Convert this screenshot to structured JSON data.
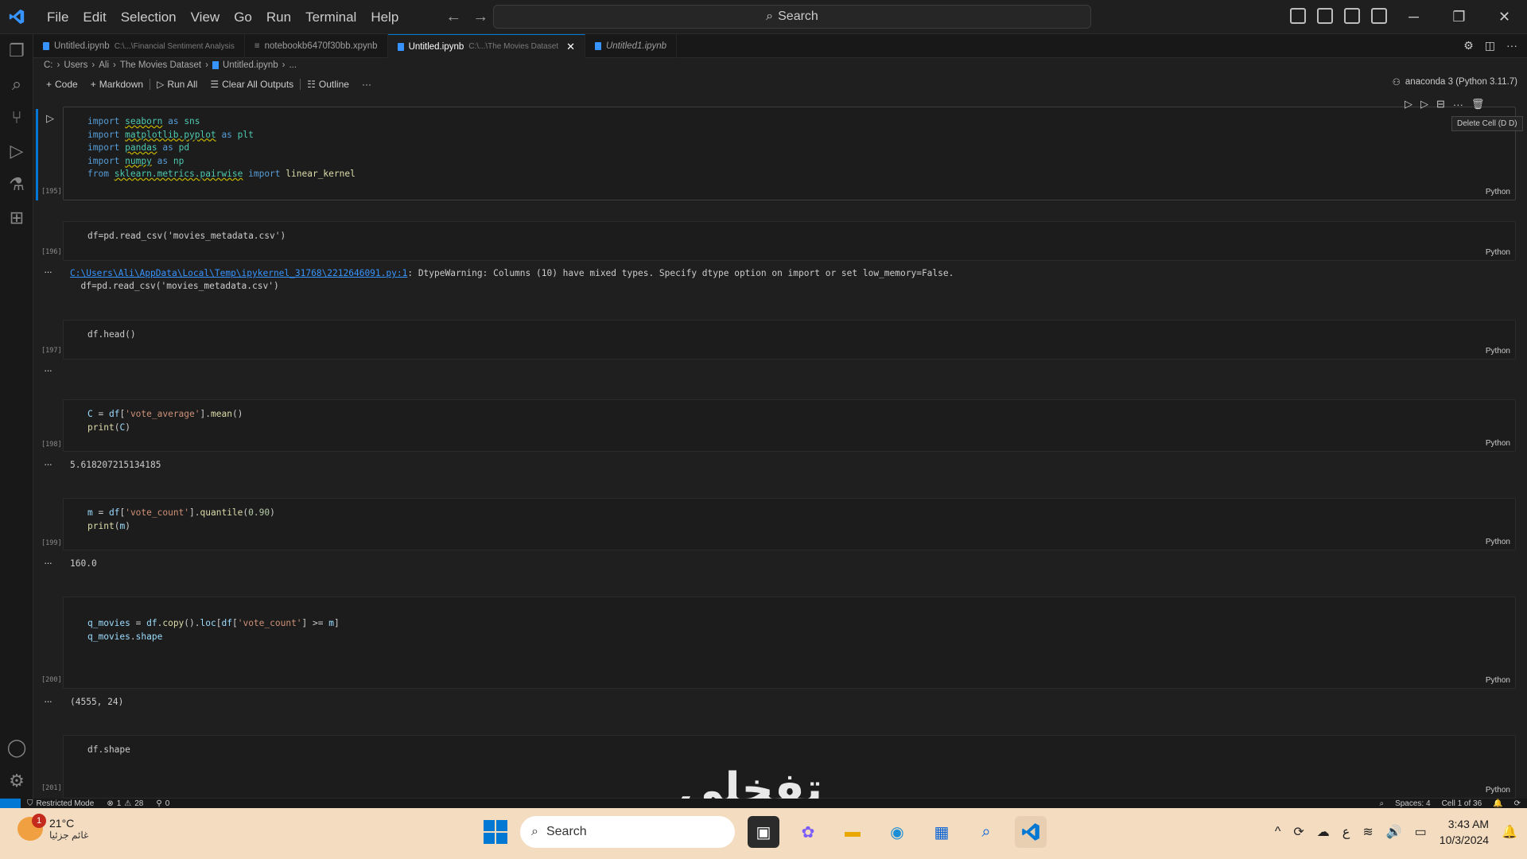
{
  "menu": [
    "File",
    "Edit",
    "Selection",
    "View",
    "Go",
    "Run",
    "Terminal",
    "Help"
  ],
  "command_search": "Search",
  "tabs": [
    {
      "label": "Untitled.ipynb",
      "desc": "C:\\...\\Financial Sentiment Analysis",
      "active": false
    },
    {
      "label": "notebookb6470f30bb.xpynb",
      "desc": "",
      "active": false
    },
    {
      "label": "Untitled.ipynb",
      "desc": "C:\\...\\The Movies Dataset",
      "active": true
    },
    {
      "label": "Untitled1.ipynb",
      "desc": "",
      "active": false
    }
  ],
  "breadcrumb": [
    "C:",
    "Users",
    "Ali",
    "The Movies Dataset",
    "Untitled.ipynb",
    "..."
  ],
  "toolbar": {
    "code": "Code",
    "markdown": "Markdown",
    "run_all": "Run All",
    "clear_outputs": "Clear All Outputs",
    "outline": "Outline",
    "more": "···"
  },
  "kernel": "anaconda 3 (Python 3.11.7)",
  "tooltip": "Delete Cell (D D)",
  "cells": [
    {
      "exec": "[195]",
      "lang": "Python"
    },
    {
      "exec": "[196]",
      "lang": "Python",
      "code": "df=pd.read_csv('movies_metadata.csv')"
    },
    {
      "exec": "[197]",
      "lang": "Python",
      "code": "df.head()"
    },
    {
      "exec": "[198]",
      "lang": "Python"
    },
    {
      "exec": "[199]",
      "lang": "Python"
    },
    {
      "exec": "[200]",
      "lang": "Python"
    },
    {
      "exec": "[201]",
      "lang": "Python",
      "code": "df.shape"
    }
  ],
  "outputs": {
    "warn_link": "C:\\Users\\Ali\\AppData\\Local\\Temp\\ipykernel_31768\\2212646091.py:1",
    "warn_text": ": DtypeWarning: Columns (10) have mixed types. Specify dtype option on import or set low_memory=False.",
    "warn_line2": "  df=pd.read_csv('movies_metadata.csv')",
    "c": "5.618207215134185",
    "m": "160.0",
    "shape": "(4555, 24)"
  },
  "statusbar": {
    "mode": "Restricted Mode",
    "errors": "1",
    "warnings": "28",
    "ports": "0",
    "spaces": "Spaces: 4",
    "cell": "Cell 1 of 36"
  },
  "watermark": "تفخلي",
  "taskbar": {
    "temp": "21°C",
    "weather": "غائم جزئيا",
    "badge": "1",
    "search": "Search",
    "time": "3:43 AM",
    "date": "10/3/2024",
    "lang": "ع"
  }
}
